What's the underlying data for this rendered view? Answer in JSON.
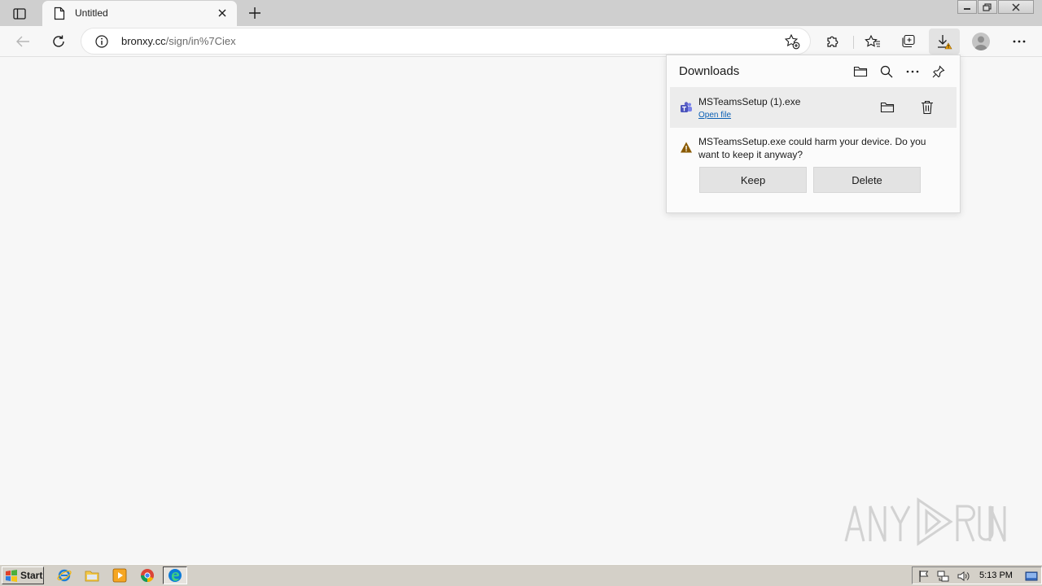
{
  "browser": {
    "tab": {
      "title": "Untitled"
    },
    "address": {
      "host": "bronxy.cc",
      "path": "/sign/in%7Ciex"
    }
  },
  "downloads": {
    "title": "Downloads",
    "item": {
      "filename": "MSTeamsSetup (1).exe",
      "open_label": "Open file"
    },
    "warning": "MSTeamsSetup.exe could harm your device. Do you want to keep it anyway?",
    "keep_label": "Keep",
    "delete_label": "Delete"
  },
  "taskbar": {
    "start_label": "Start",
    "clock": "5:13 PM"
  },
  "colors": {
    "accent": "#0a5fb4",
    "warning": "#8a5a00",
    "teams": "#5b5fc7"
  }
}
